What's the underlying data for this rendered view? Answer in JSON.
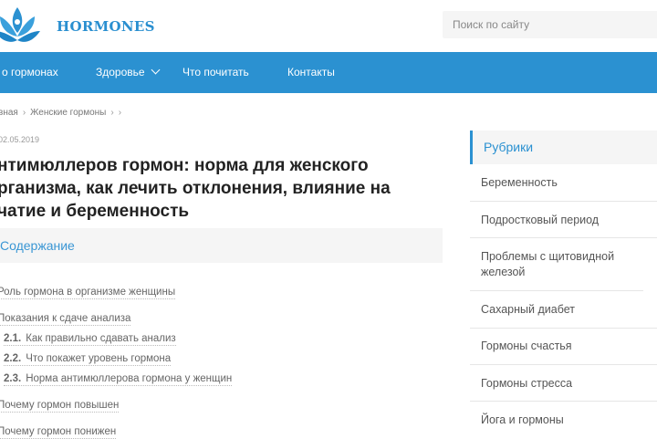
{
  "header": {
    "brand": "HORMONES",
    "search_placeholder": "Поиск по сайту"
  },
  "nav": [
    "о гормонах",
    "Здоровье",
    "Что почитать",
    "Контакты"
  ],
  "breadcrumb": [
    "вная",
    "Женские гормоны"
  ],
  "article": {
    "date": "02.05.2019",
    "title": "нтимюллеров гормон: норма для женского рганизма, как лечить отклонения, влияние на чатие и беременность"
  },
  "toc": {
    "title": "Содержание",
    "items": [
      {
        "num": "",
        "label": "Роль гормона в организме женщины"
      },
      {
        "num": "",
        "label": "Показания к сдаче анализа"
      },
      {
        "num": "2.1.",
        "label": "Как правильно сдавать анализ"
      },
      {
        "num": "2.2.",
        "label": "Что покажет уровень гормона"
      },
      {
        "num": "2.3.",
        "label": "Норма антимюллерова гормона у женщин"
      },
      {
        "num": "",
        "label": "Почему гормон повышен"
      },
      {
        "num": "",
        "label": "Почему гормон понижен"
      }
    ]
  },
  "sidebar": {
    "title": "Рубрики",
    "items": [
      "Беременность",
      "Подростковый период",
      "Проблемы с щитовидной железой",
      "Сахарный диабет",
      "Гормоны счастья",
      "Гормоны стресса",
      "Йога и гормоны"
    ]
  },
  "colors": {
    "accent": "#2b91d1"
  }
}
